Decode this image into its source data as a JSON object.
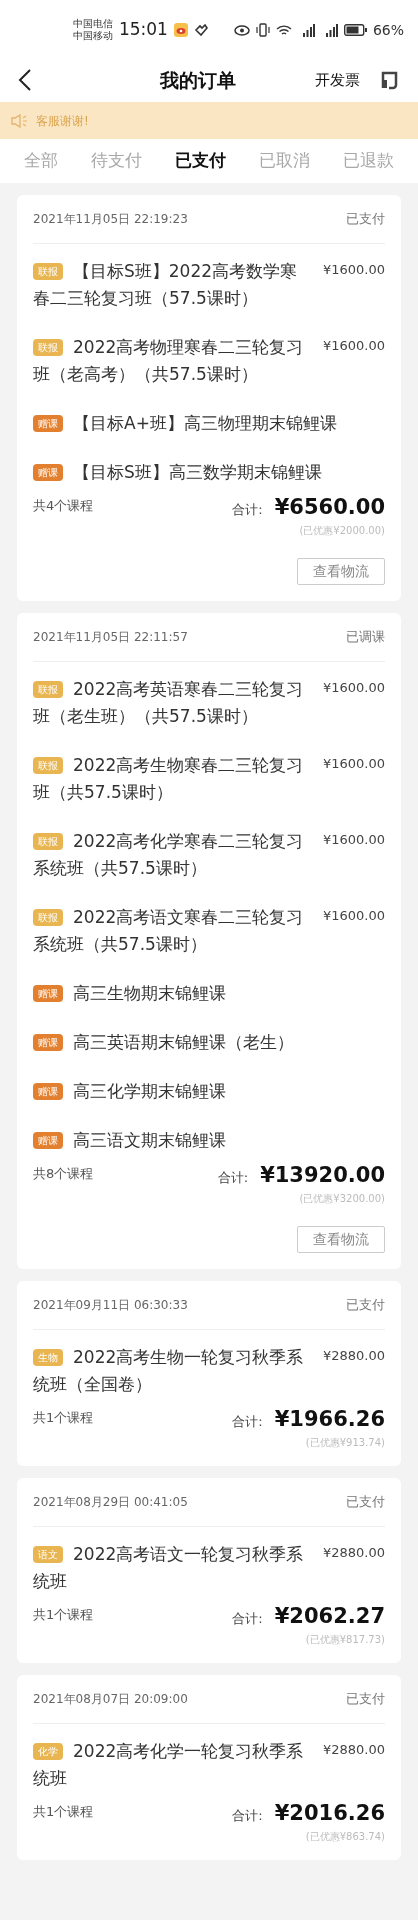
{
  "status_bar": {
    "carriers": [
      "中国电信",
      "中国移动"
    ],
    "time": "15:01",
    "battery": "66%"
  },
  "header": {
    "title": "我的订单",
    "action": "开发票"
  },
  "notice": {
    "text": "客服谢谢!"
  },
  "tabs": [
    {
      "label": "全部",
      "selected": false
    },
    {
      "label": "待支付",
      "selected": false
    },
    {
      "label": "已支付",
      "selected": true
    },
    {
      "label": "已取消",
      "selected": false
    },
    {
      "label": "已退款",
      "selected": false
    }
  ],
  "orders": [
    {
      "date": "2021年11月05日 22:19:23",
      "status": "已支付",
      "items": [
        {
          "badge": "联报",
          "color": "#e8b551",
          "title": "【目标S班】2022高考数学寒春二三轮复习班（57.5课时）",
          "price": "¥1600.00"
        },
        {
          "badge": "联报",
          "color": "#e8b551",
          "title": "2022高考物理寒春二三轮复习班（老高考）（共57.5课时）",
          "price": "¥1600.00"
        },
        {
          "badge": "赠课",
          "color": "#e2802f",
          "title": "【目标A+班】高三物理期末锦鲤课"
        },
        {
          "badge": "赠课",
          "color": "#e2802f",
          "title": "【目标S班】高三数学期末锦鲤课"
        }
      ],
      "count": "共4个课程",
      "total_label": "合计:",
      "total": "¥6560.00",
      "discount": "(已优惠¥2000.00)",
      "button": "查看物流"
    },
    {
      "date": "2021年11月05日 22:11:57",
      "status": "已调课",
      "items": [
        {
          "badge": "联报",
          "color": "#e8b551",
          "title": "2022高考英语寒春二三轮复习班（老生班）（共57.5课时）",
          "price": "¥1600.00"
        },
        {
          "badge": "联报",
          "color": "#e8b551",
          "title": "2022高考生物寒春二三轮复习班（共57.5课时）",
          "price": "¥1600.00"
        },
        {
          "badge": "联报",
          "color": "#e8b551",
          "title": "2022高考化学寒春二三轮复习系统班（共57.5课时）",
          "price": "¥1600.00"
        },
        {
          "badge": "联报",
          "color": "#e8b551",
          "title": "2022高考语文寒春二三轮复习系统班（共57.5课时）",
          "price": "¥1600.00"
        },
        {
          "badge": "赠课",
          "color": "#e2802f",
          "title": "高三生物期末锦鲤课"
        },
        {
          "badge": "赠课",
          "color": "#e2802f",
          "title": "高三英语期末锦鲤课（老生）"
        },
        {
          "badge": "赠课",
          "color": "#e2802f",
          "title": "高三化学期末锦鲤课"
        },
        {
          "badge": "赠课",
          "color": "#e2802f",
          "title": "高三语文期末锦鲤课"
        }
      ],
      "count": "共8个课程",
      "total_label": "合计:",
      "total": "¥13920.00",
      "discount": "(已优惠¥3200.00)",
      "button": "查看物流"
    },
    {
      "date": "2021年09月11日 06:30:33",
      "status": "已支付",
      "items": [
        {
          "badge": "生物",
          "color": "#e8b551",
          "title": "2022高考生物一轮复习秋季系统班（全国卷）",
          "price": "¥2880.00"
        }
      ],
      "count": "共1个课程",
      "total_label": "合计:",
      "total": "¥1966.26",
      "discount": "(已优惠¥913.74)"
    },
    {
      "date": "2021年08月29日 00:41:05",
      "status": "已支付",
      "items": [
        {
          "badge": "语文",
          "color": "#e8b551",
          "title": "2022高考语文一轮复习秋季系统班",
          "price": "¥2880.00"
        }
      ],
      "count": "共1个课程",
      "total_label": "合计:",
      "total": "¥2062.27",
      "discount": "(已优惠¥817.73)"
    },
    {
      "date": "2021年08月07日 20:09:00",
      "status": "已支付",
      "items": [
        {
          "badge": "化学",
          "color": "#e8b551",
          "title": "2022高考化学一轮复习秋季系统班",
          "price": "¥2880.00"
        }
      ],
      "count": "共1个课程",
      "total_label": "合计:",
      "total": "¥2016.26",
      "discount": "(已优惠¥863.74)"
    }
  ]
}
